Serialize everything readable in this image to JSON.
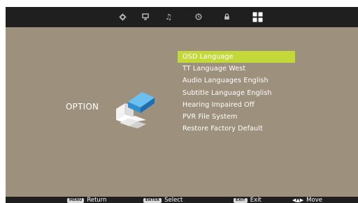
{
  "topbar": {
    "tabs": [
      {
        "name": "picture",
        "icon": "gear-icon"
      },
      {
        "name": "sound",
        "icon": "tv-icon"
      },
      {
        "name": "music",
        "icon": "music-note-icon"
      },
      {
        "name": "time",
        "icon": "clock-icon"
      },
      {
        "name": "lock",
        "icon": "lock-icon"
      },
      {
        "name": "option",
        "icon": "grid-icon",
        "active": true
      }
    ]
  },
  "category": {
    "label": "OPTION",
    "icon": "option-blocks-icon"
  },
  "menu": {
    "items": [
      {
        "label": "OSD Language",
        "selected": true
      },
      {
        "label": "TT Language West"
      },
      {
        "label": "Audio Languages English"
      },
      {
        "label": "Subtitle Language English"
      },
      {
        "label": "Hearing Impaired Off"
      },
      {
        "label": "PVR File System"
      },
      {
        "label": "Restore Factory Default"
      }
    ]
  },
  "footer": {
    "return_key": "MENU",
    "return_label": "Return",
    "select_key": "ENTER",
    "select_label": "Select",
    "exit_key": "EXIT",
    "exit_label": "Exit",
    "move_label": "Move"
  },
  "colors": {
    "background": "#9d917e",
    "bar": "#1f1f1f",
    "highlight": "#c3d93a",
    "accent_blue": "#3fa3e0"
  }
}
